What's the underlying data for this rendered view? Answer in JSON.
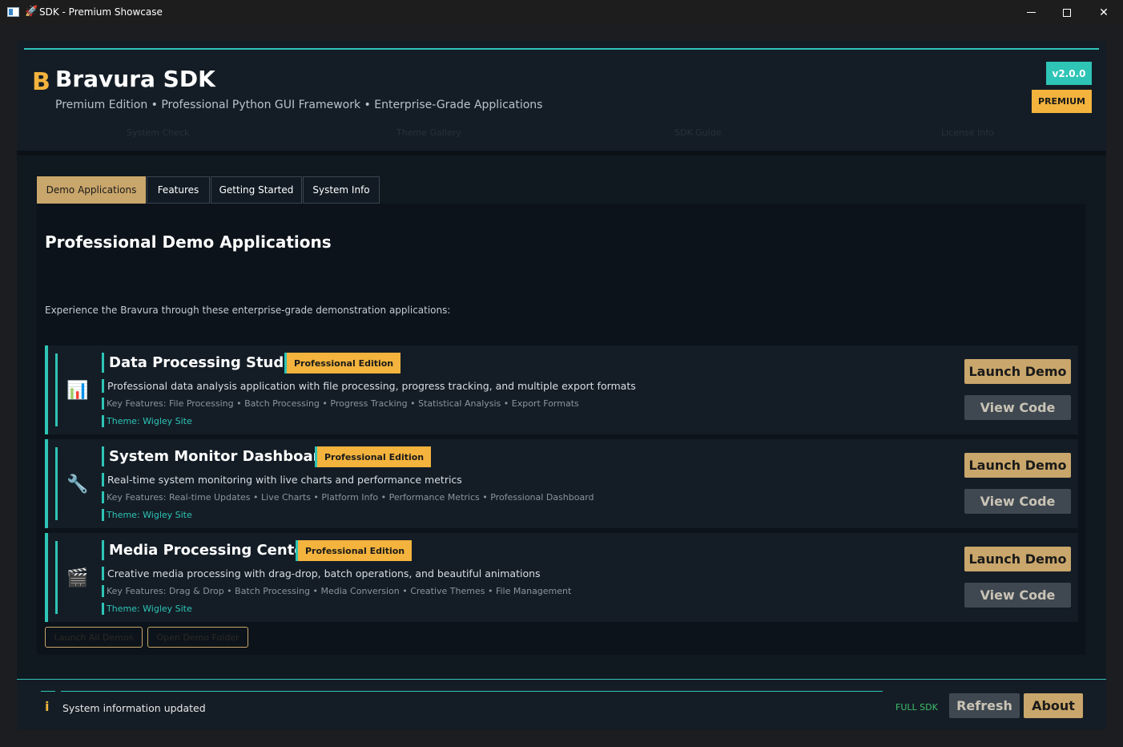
{
  "window": {
    "title": "SDK - Premium Showcase",
    "app_icon": "window-app-icon",
    "title_icon": "rocket-icon"
  },
  "header": {
    "logo_letter": "B",
    "brand": "Bravura SDK",
    "subtitle": "Premium Edition • Professional Python GUI Framework • Enterprise-Grade Applications",
    "version": "v2.0.0",
    "edition_badge": "PREMIUM",
    "quick_links": [
      "System Check",
      "Theme Gallery",
      "SDK Guide",
      "License Info"
    ]
  },
  "tabs": [
    {
      "label": "Demo Applications",
      "active": true
    },
    {
      "label": "Features",
      "active": false
    },
    {
      "label": "Getting Started",
      "active": false
    },
    {
      "label": "System Info",
      "active": false
    }
  ],
  "content": {
    "heading": "Professional Demo Applications",
    "intro": "Experience the Bravura through these enterprise-grade demonstration applications:",
    "demos": [
      {
        "name": "Data Processing Studio",
        "edition": "Professional Edition",
        "icon": "bar-chart-icon",
        "description": "Professional data analysis application with file processing, progress tracking, and multiple export formats",
        "features": "Key Features: File Processing • Batch Processing • Progress Tracking • Statistical Analysis • Export Formats",
        "theme": "Theme: Wigley Site",
        "launch_label": "Launch Demo",
        "code_label": "View Code"
      },
      {
        "name": "System Monitor Dashboard",
        "edition": "Professional Edition",
        "icon": "wrench-icon",
        "description": "Real-time system monitoring with live charts and performance metrics",
        "features": "Key Features: Real-time Updates • Live Charts • Platform Info • Performance Metrics • Professional Dashboard",
        "theme": "Theme: Wigley Site",
        "launch_label": "Launch Demo",
        "code_label": "View Code"
      },
      {
        "name": "Media Processing Center",
        "edition": "Professional Edition",
        "icon": "clapperboard-icon",
        "description": "Creative media processing with drag-drop, batch operations, and beautiful animations",
        "features": "Key Features: Drag & Drop • Batch Processing • Media Conversion • Creative Themes • File Management",
        "theme": "Theme: Wigley Site",
        "launch_label": "Launch Demo",
        "code_label": "View Code"
      }
    ],
    "launch_all_label": "Launch All Demos",
    "open_folder_label": "Open Demo Folder"
  },
  "statusbar": {
    "icon": "info-icon",
    "message": "System information updated",
    "sdk_label": "FULL SDK",
    "refresh_label": "Refresh",
    "about_label": "About"
  },
  "colors": {
    "accent_teal": "#2ec4b6",
    "accent_gold": "#f3b33d",
    "button_tan": "#c9a66b",
    "button_gray": "#3f4851",
    "status_green": "#3fbf6a"
  }
}
